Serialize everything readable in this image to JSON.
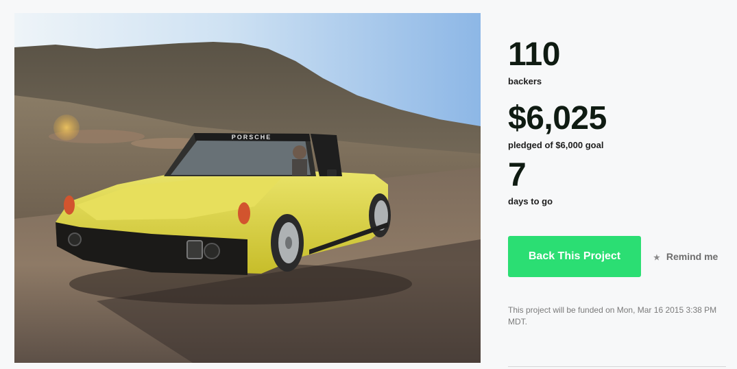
{
  "project": {
    "image_alt": "Yellow Porsche 914 driving on a desert road",
    "windshield_banner": "PORSCHE"
  },
  "stats": {
    "backers_count": "110",
    "backers_label": "backers",
    "pledged_amount": "$6,025",
    "pledged_label": "pledged of $6,000 goal",
    "days_count": "7",
    "days_label": "days to go"
  },
  "actions": {
    "back_label": "Back This Project",
    "remind_label": "Remind me",
    "remind_icon": "star-icon"
  },
  "funding": {
    "note": "This project will be funded on Mon, Mar 16 2015 3:38 PM MDT."
  },
  "colors": {
    "accent": "#2bde73",
    "stat_text": "#0f1b12",
    "muted_text": "#7a7a7a"
  }
}
